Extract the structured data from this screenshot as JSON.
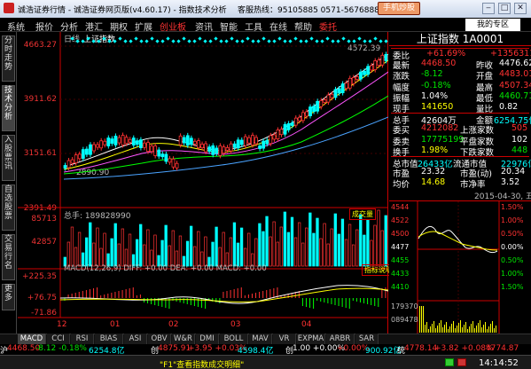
{
  "title_bar": {
    "title": "诚浩证券行情 - 诚浩证券网页版(v4.60.17) - 指数技术分析",
    "server": "客服热线：95105885  0571-56768888",
    "trade_btn": "手机炒股"
  },
  "menu": {
    "items": [
      "系统",
      "报价",
      "分析",
      "港汇",
      "期权",
      "扩展",
      "创业板",
      "资讯",
      "智能",
      "工具",
      "在线",
      "帮助",
      "委托"
    ],
    "zone": "我的专区"
  },
  "side_tabs": [
    "分时走势",
    "技术分析",
    "入股票讯",
    "自选股票",
    "交易行名",
    "更多"
  ],
  "chart": {
    "period": "日线",
    "index_name": "上证指数",
    "high_label": "4572.39",
    "low_label": "2890.90",
    "y_ticks": [
      "4663.27",
      "3911.62",
      "3151.61",
      "2391.49"
    ],
    "vol_label": "总手: 189828990",
    "vol_btn": "成交量",
    "vol_ticks": [
      "85713",
      "42857"
    ],
    "macd_label": "MACD(12,26,9) DIFF: +0.00  DEA: +0.00  MACD: +0.00",
    "macd_btn": "指标说明",
    "macd_ticks": [
      "+225.35",
      "+76.75",
      "-71.86"
    ],
    "x_ticks": [
      "12",
      "01",
      "02",
      "03",
      "04"
    ]
  },
  "chart_data": {
    "type": "candlestick",
    "xlabel": "",
    "ylabel": "",
    "ylim": [
      2391.49,
      4663.27
    ],
    "x_ticks": [
      "12",
      "01",
      "02",
      "03",
      "04"
    ],
    "high": 4572.39,
    "low": 2890.9
  },
  "quote": {
    "title": "上证指数  1A0001",
    "rows": [
      [
        [
          "委比",
          "w"
        ],
        [
          "+61.69%",
          "r"
        ],
        [
          "+13563117",
          "r"
        ]
      ],
      [
        [
          "最新",
          "w"
        ],
        [
          "4468.50",
          "r"
        ],
        [
          "昨收",
          "w"
        ],
        [
          "4476.62",
          "w"
        ]
      ],
      [
        [
          "涨跌",
          "w"
        ],
        [
          "-8.12",
          "g"
        ],
        [
          "开盘",
          "w"
        ],
        [
          "4483.01",
          "r"
        ]
      ],
      [
        [
          "幅度",
          "w"
        ],
        [
          "-0.18%",
          "g"
        ],
        [
          "最高",
          "w"
        ],
        [
          "4507.34",
          "r"
        ]
      ],
      [
        [
          "振幅",
          "w"
        ],
        [
          "1.04%",
          "w"
        ],
        [
          "最低",
          "w"
        ],
        [
          "4460.71",
          "g"
        ]
      ],
      [
        [
          "现手",
          "w"
        ],
        [
          "141650",
          "y"
        ],
        [
          "量比",
          "w"
        ],
        [
          "0.82",
          "w"
        ]
      ],
      [
        [
          "总手",
          "w"
        ],
        [
          "42604万",
          "w"
        ],
        [
          "金额",
          "w"
        ],
        [
          "6254.75亿",
          "c"
        ]
      ],
      [
        [
          "委买",
          "w"
        ],
        [
          "4212082",
          "r"
        ],
        [
          "上涨家数",
          "w"
        ],
        [
          "505",
          "r"
        ]
      ],
      [
        [
          "委卖",
          "w"
        ],
        [
          "17775199",
          "g"
        ],
        [
          "平盘家数",
          "w"
        ],
        [
          "102",
          "w"
        ]
      ],
      [
        [
          "换手",
          "w"
        ],
        [
          "1.98%",
          "y"
        ],
        [
          "下跌家数",
          "w"
        ],
        [
          "448",
          "g"
        ]
      ],
      [
        [
          "总市值",
          "w"
        ],
        [
          "26433亿",
          "c"
        ],
        [
          "流通市值",
          "w"
        ],
        [
          "22976亿",
          "c"
        ]
      ],
      [
        [
          "市盈",
          "w"
        ],
        [
          "23.32",
          "w"
        ],
        [
          "市盈(动)",
          "w"
        ],
        [
          "20.34",
          "w"
        ]
      ],
      [
        [
          "均价",
          "w"
        ],
        [
          "14.68",
          "y"
        ],
        [
          "市净率",
          "w"
        ],
        [
          "3.52",
          "w"
        ]
      ]
    ],
    "date": "2015-04-30, 五",
    "mini_left": [
      "4544",
      "4522",
      "4500",
      "4477",
      "4455",
      "4433",
      "4410"
    ],
    "mini_right": [
      "1.50%",
      "1.00%",
      "0.50%",
      "0.00%",
      "0.50%",
      "1.00%",
      "1.50%"
    ],
    "mini_vol": [
      "179370",
      "089478"
    ]
  },
  "tabs": [
    "MACD",
    "CCI",
    "RSI",
    "BIAS",
    "ASI",
    "OBV",
    "W&R",
    "DMI",
    "BOLL",
    "MAV",
    "VR",
    "EXPMA",
    "ARBR",
    "SAR"
  ],
  "ticker": [
    [
      "沪",
      "w"
    ],
    [
      "4468.50",
      "r"
    ],
    [
      "-8.12  -0.18%",
      "g"
    ],
    [
      "6254.8亿",
      "c"
    ],
    [
      "创",
      "w"
    ],
    [
      "4875.91",
      "r"
    ],
    [
      "+3.95 +0.03%",
      "r"
    ],
    [
      "4598.4亿",
      "c"
    ],
    [
      "创",
      "w"
    ],
    [
      "1.00  +0.00%",
      "w"
    ],
    [
      "+0.00%",
      "r"
    ],
    [
      "900.92亿",
      "c"
    ],
    [
      "统",
      "w"
    ],
    [
      "4778.14",
      "r"
    ],
    [
      "+3.82  +0.08%",
      "r"
    ],
    [
      "4774.87",
      "r"
    ]
  ],
  "hint": {
    "text": "\"F1\"查看指数成交明细\"",
    "time": "14:14:52"
  }
}
